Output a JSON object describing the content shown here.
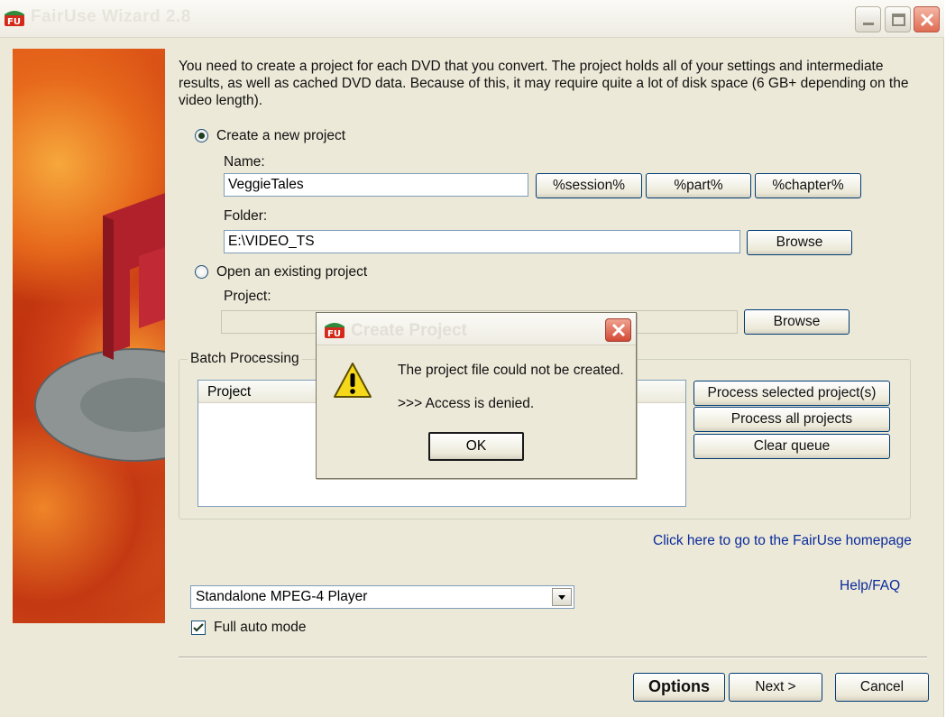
{
  "window": {
    "title": "FairUse Wizard 2.8",
    "app_icon_text": "FU"
  },
  "intro_text": "You need to create a project for each DVD that you convert. The project holds all of your settings and intermediate results, as well as cached DVD data. Because of this, it may require quite a lot of disk space (6 GB+ depending on the video length).",
  "new_project": {
    "radio_label": "Create a new project",
    "selected": true,
    "name_label": "Name:",
    "name_value": "VeggieTales",
    "token_buttons": [
      "%session%",
      "%part%",
      "%chapter%"
    ],
    "folder_label": "Folder:",
    "folder_value": "E:\\VIDEO_TS",
    "browse_label": "Browse"
  },
  "existing_project": {
    "radio_label": "Open an existing project",
    "selected": false,
    "project_label": "Project:",
    "project_value": "",
    "browse_label": "Browse"
  },
  "batch": {
    "group_label": "Batch Processing",
    "column_header": "Project",
    "buttons": [
      "Process selected project(s)",
      "Process all projects",
      "Clear queue"
    ]
  },
  "links": {
    "homepage": "Click here to go to the FairUse homepage",
    "help": "Help/FAQ"
  },
  "profile_select": {
    "value": "Standalone MPEG-4 Player"
  },
  "full_auto": {
    "label": "Full auto mode",
    "checked": true
  },
  "footer": {
    "options": "Options",
    "next": "Next >",
    "cancel": "Cancel"
  },
  "dialog": {
    "title": "Create Project",
    "message": "The project file could not be created.",
    "detail": ">>> Access is denied.",
    "ok": "OK",
    "icon": "warning-icon"
  },
  "colors": {
    "window_bg": "#ece9d8",
    "link": "#0a2a9c",
    "button_border": "#003c74"
  }
}
